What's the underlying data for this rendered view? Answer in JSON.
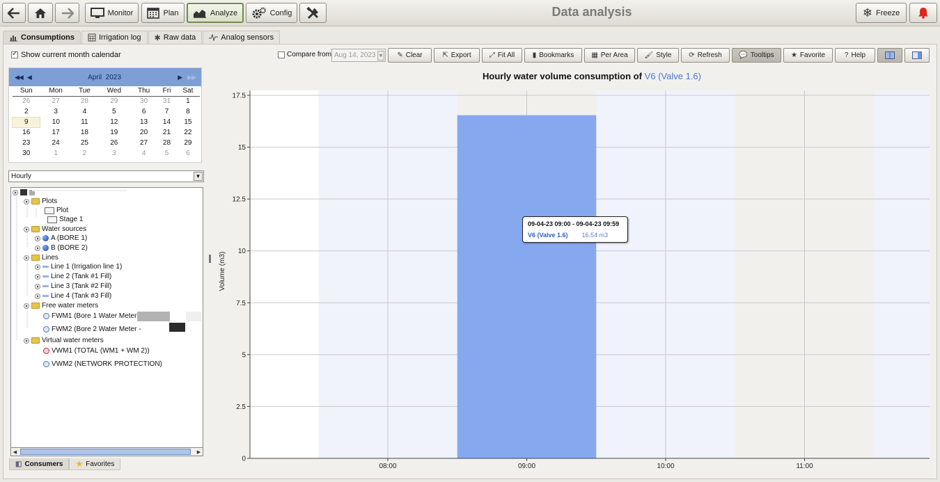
{
  "header": {
    "title": "Data analysis",
    "nav": [
      {
        "id": "back",
        "icon": "back-arrow-icon"
      },
      {
        "id": "home",
        "icon": "home-icon"
      },
      {
        "id": "forward",
        "icon": "forward-arrow-icon"
      }
    ],
    "modules": [
      {
        "label": "Monitor",
        "icon": "monitor-icon"
      },
      {
        "label": "Plan",
        "icon": "calendar-icon"
      },
      {
        "label": "Analyze",
        "icon": "chart-icon",
        "active": true
      },
      {
        "label": "Config",
        "icon": "gears-icon"
      }
    ],
    "tools_icon": "tools-icon",
    "freeze_label": "Freeze",
    "alarm_icon": "bell-icon"
  },
  "tabs": {
    "items": [
      "Consumptions",
      "Irrigation log",
      "Raw data",
      "Analog sensors"
    ],
    "active": "Consumptions"
  },
  "sidebar": {
    "show_calendar_label": "Show current month calendar",
    "show_calendar_checked": true,
    "calendar": {
      "month_label": "April",
      "year_label": "2023",
      "weekdays": [
        "Sun",
        "Mon",
        "Tue",
        "Wed",
        "Thu",
        "Fri",
        "Sat"
      ],
      "weeks": [
        [
          "26",
          "27",
          "28",
          "29",
          "30",
          "31",
          "1"
        ],
        [
          "2",
          "3",
          "4",
          "5",
          "6",
          "7",
          "8"
        ],
        [
          "9",
          "10",
          "11",
          "12",
          "13",
          "14",
          "15"
        ],
        [
          "16",
          "17",
          "18",
          "19",
          "20",
          "21",
          "22"
        ],
        [
          "23",
          "24",
          "25",
          "26",
          "27",
          "28",
          "29"
        ],
        [
          "30",
          "1",
          "2",
          "3",
          "4",
          "5",
          "6"
        ]
      ],
      "selected_day": "9"
    },
    "period_value": "Hourly",
    "tree": {
      "plots_label": "Plots",
      "plot_label": "Plot",
      "stage_label": "Stage 1",
      "water_sources_label": "Water sources",
      "source_a": "A (BORE 1)",
      "source_b": "B (BORE 2)",
      "lines_label": "Lines",
      "line1": "Line 1 (Irrigation line 1)",
      "line2": "Line 2 (Tank #1 Fill)",
      "line3": "Line 3 (Tank #2 Fill)",
      "line4": "Line 4 (Tank #3 Fill)",
      "free_meters_label": "Free water meters",
      "fwm1": "FWM1 (Bore 1 Water Meter -",
      "fwm2": "FWM2 (Bore 2 Water Meter -",
      "virtual_meters_label": "Virtual water meters",
      "vwm1": "VWM1 (TOTAL (WM1 + WM 2))",
      "vwm2": "VWM2 (NETWORK PROTECTION)"
    },
    "bottom_tabs": [
      "Consumers",
      "Favorites"
    ]
  },
  "toolbar": {
    "compare_label": "Compare from",
    "compare_date": "Aug 14, 2023",
    "buttons": [
      "Clear",
      "Export",
      "Fit All",
      "Bookmarks",
      "Per Area",
      "Style",
      "Refresh",
      "Tooltips",
      "Favorite",
      "Help"
    ]
  },
  "chart_data": {
    "type": "bar",
    "title": "Hourly water volume consumption of",
    "title_highlight": "V6 (Valve 1.6)",
    "ylabel": "Volume (m3)",
    "xlabel": "",
    "x_ticks": [
      "08:00",
      "09:00",
      "10:00",
      "11:00"
    ],
    "y_ticks": [
      "0",
      "2.5",
      "5",
      "7.5",
      "10",
      "12.5",
      "15",
      "17.5"
    ],
    "ylim": [
      0,
      17.5
    ],
    "categories": [
      "09:00"
    ],
    "series": [
      {
        "name": "V6 (Valve 1.6)",
        "values": [
          16.54
        ]
      }
    ],
    "bar_color": "#86a8ee",
    "band_color": "#f0f2fc",
    "grid": true,
    "tooltip": {
      "range": "09-04-23 09:00 - 09-04-23 09:59",
      "series": "V6 (Valve 1.6)",
      "value": "16.54 m3"
    }
  }
}
